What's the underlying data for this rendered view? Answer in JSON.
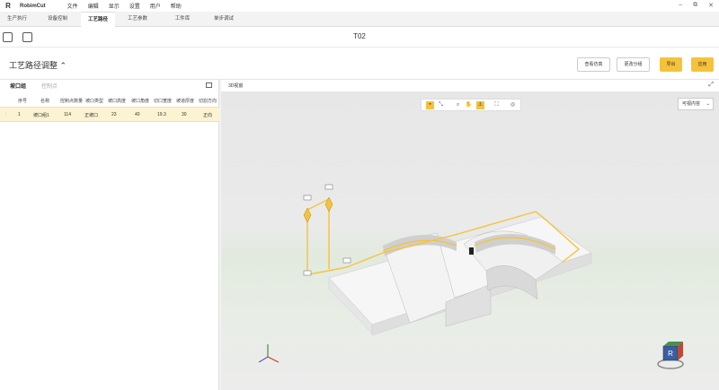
{
  "app": {
    "name": "RobimCut"
  },
  "menu": [
    "文件",
    "编辑",
    "显示",
    "设置",
    "用户",
    "帮助"
  ],
  "tabs": [
    "生产执行",
    "设备控制",
    "工艺路径",
    "工艺参数",
    "工件库",
    "单步调试"
  ],
  "active_tab_index": 2,
  "document": {
    "title": "T02"
  },
  "page": {
    "title": "工艺路径调整",
    "buttons": {
      "view_sim": "查看仿真",
      "change_part": "更改分组",
      "export": "导出",
      "apply": "应用"
    }
  },
  "left_panel": {
    "tab_active": "坡口组",
    "tab_inactive": "控制点",
    "columns": [
      "序号",
      "名称",
      "控制点数量",
      "坡口类型",
      "坡口高度",
      "坡口角度",
      "切口宽度",
      "坡道厚度",
      "切割方向"
    ],
    "rows": [
      {
        "index": "1",
        "name": "坡口组1",
        "points": "114",
        "type": "正坡口",
        "height": "23",
        "angle": "40",
        "width": "19.3",
        "thickness": "30",
        "dir": "正向"
      }
    ]
  },
  "right_panel": {
    "title": "3D视窗",
    "view_select": "可视内容"
  },
  "icons": [
    "window-minimize-icon",
    "window-maximize-icon",
    "window-close-icon",
    "import-icon",
    "save-icon",
    "fullscreen-icon",
    "axis-triad-icon",
    "view-cube-icon"
  ],
  "colors": {
    "accent": "#f5c33b",
    "selected_row": "#fbf3d2"
  }
}
